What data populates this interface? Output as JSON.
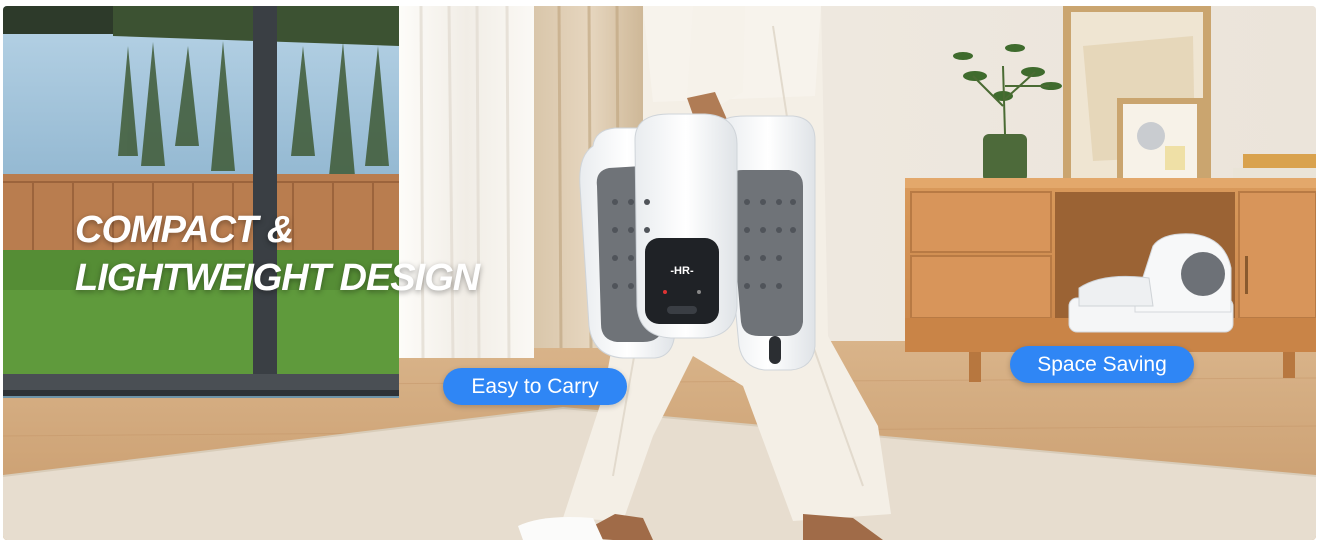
{
  "banner": {
    "headline_line1": "COMPACT &",
    "headline_line2": "LIGHTWEIGHT DESIGN",
    "badges": {
      "carry": "Easy to Carry",
      "space": "Space Saving"
    },
    "device_display_text": "-HR-",
    "accent_color": "#2f86f5"
  }
}
